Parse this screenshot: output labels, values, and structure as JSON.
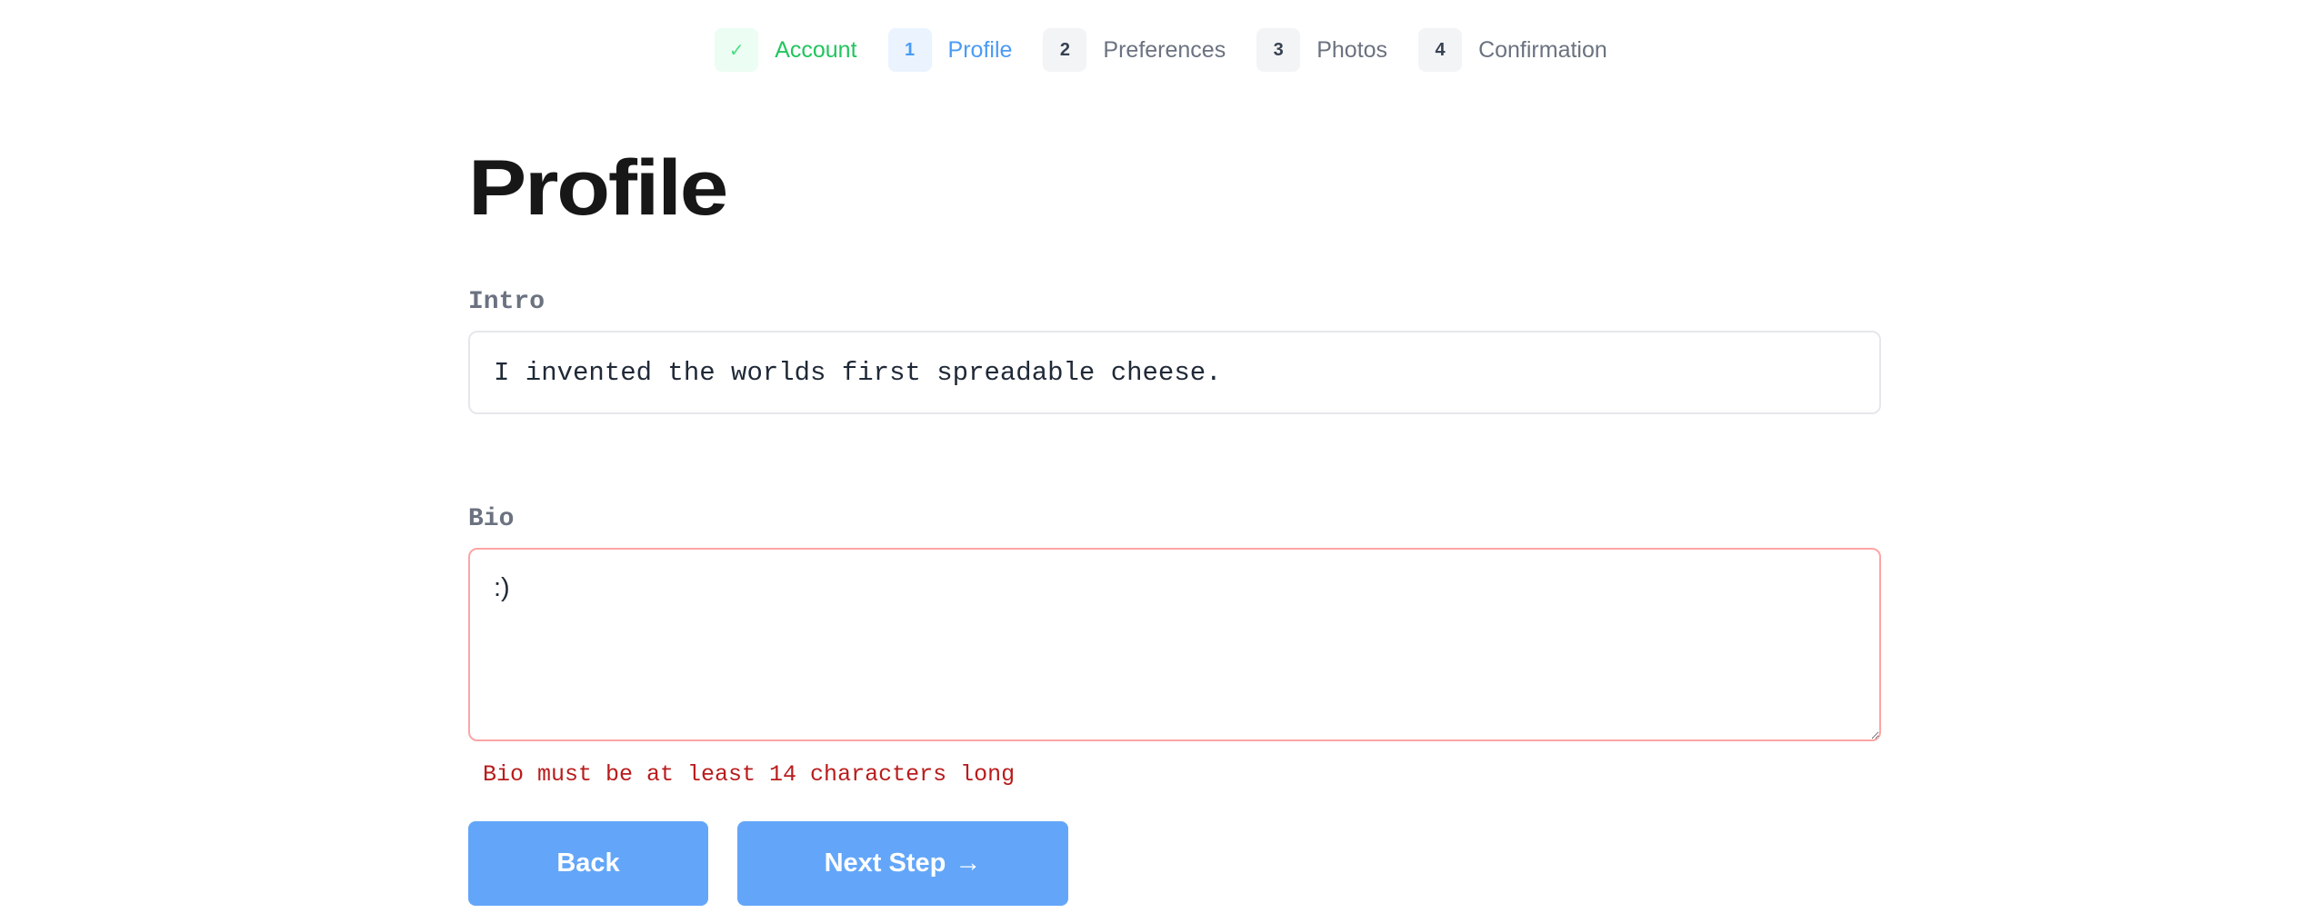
{
  "stepper": {
    "steps": [
      {
        "badge": "✓",
        "label": "Account",
        "state": "done"
      },
      {
        "badge": "1",
        "label": "Profile",
        "state": "active"
      },
      {
        "badge": "2",
        "label": "Preferences",
        "state": "pending"
      },
      {
        "badge": "3",
        "label": "Photos",
        "state": "pending"
      },
      {
        "badge": "4",
        "label": "Confirmation",
        "state": "pending"
      }
    ]
  },
  "page": {
    "title": "Profile"
  },
  "form": {
    "intro": {
      "label": "Intro",
      "value": "I invented the worlds first spreadable cheese."
    },
    "bio": {
      "label": "Bio",
      "value": ":)",
      "error": "Bio must be at least 14 characters long"
    }
  },
  "actions": {
    "back_label": "Back",
    "next_label": "Next Step",
    "next_icon": "→"
  },
  "colors": {
    "accent": "#63a6f9",
    "done": "#22c55e",
    "error": "#b91c1c",
    "error_border": "#fca5a5"
  }
}
